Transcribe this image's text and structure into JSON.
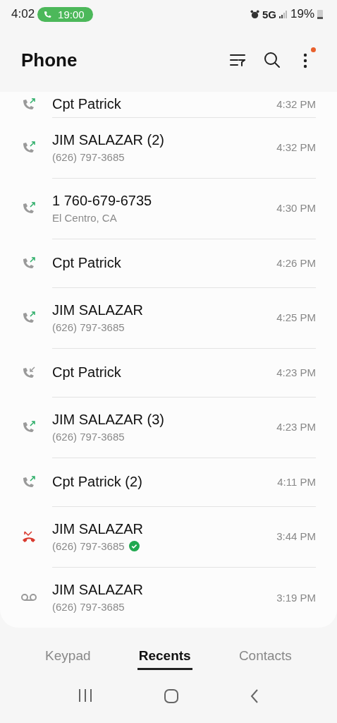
{
  "status_bar": {
    "time": "4:02",
    "call_chip": "19:00",
    "network": "5G",
    "battery": "19%"
  },
  "header": {
    "title": "Phone",
    "menu_badge": true
  },
  "calls": [
    {
      "kind": "outgoing",
      "name": "Cpt Patrick",
      "time": "4:32 PM",
      "cut": true
    },
    {
      "kind": "outgoing",
      "name": "JIM SALAZAR (2)",
      "detail": "(626) 797-3685",
      "time": "4:32 PM"
    },
    {
      "kind": "outgoing",
      "name": "1 760-679-6735",
      "detail": "El Centro, CA",
      "time": "4:30 PM"
    },
    {
      "kind": "outgoing",
      "name": "Cpt Patrick",
      "time": "4:26 PM"
    },
    {
      "kind": "outgoing",
      "name": "JIM SALAZAR",
      "detail": "(626) 797-3685",
      "time": "4:25 PM"
    },
    {
      "kind": "incoming",
      "name": "Cpt Patrick",
      "time": "4:23 PM"
    },
    {
      "kind": "outgoing",
      "name": "JIM SALAZAR (3)",
      "detail": "(626) 797-3685",
      "time": "4:23 PM"
    },
    {
      "kind": "outgoing",
      "name": "Cpt Patrick (2)",
      "time": "4:11 PM"
    },
    {
      "kind": "rejected",
      "name": "JIM SALAZAR",
      "detail": "(626) 797-3685",
      "verified": true,
      "time": "3:44 PM"
    },
    {
      "kind": "voicemail",
      "name": "JIM SALAZAR",
      "detail": "(626) 797-3685",
      "time": "3:19 PM"
    }
  ],
  "tabs": [
    {
      "label": "Keypad",
      "selected": false
    },
    {
      "label": "Recents",
      "selected": true
    },
    {
      "label": "Contacts",
      "selected": false
    }
  ]
}
